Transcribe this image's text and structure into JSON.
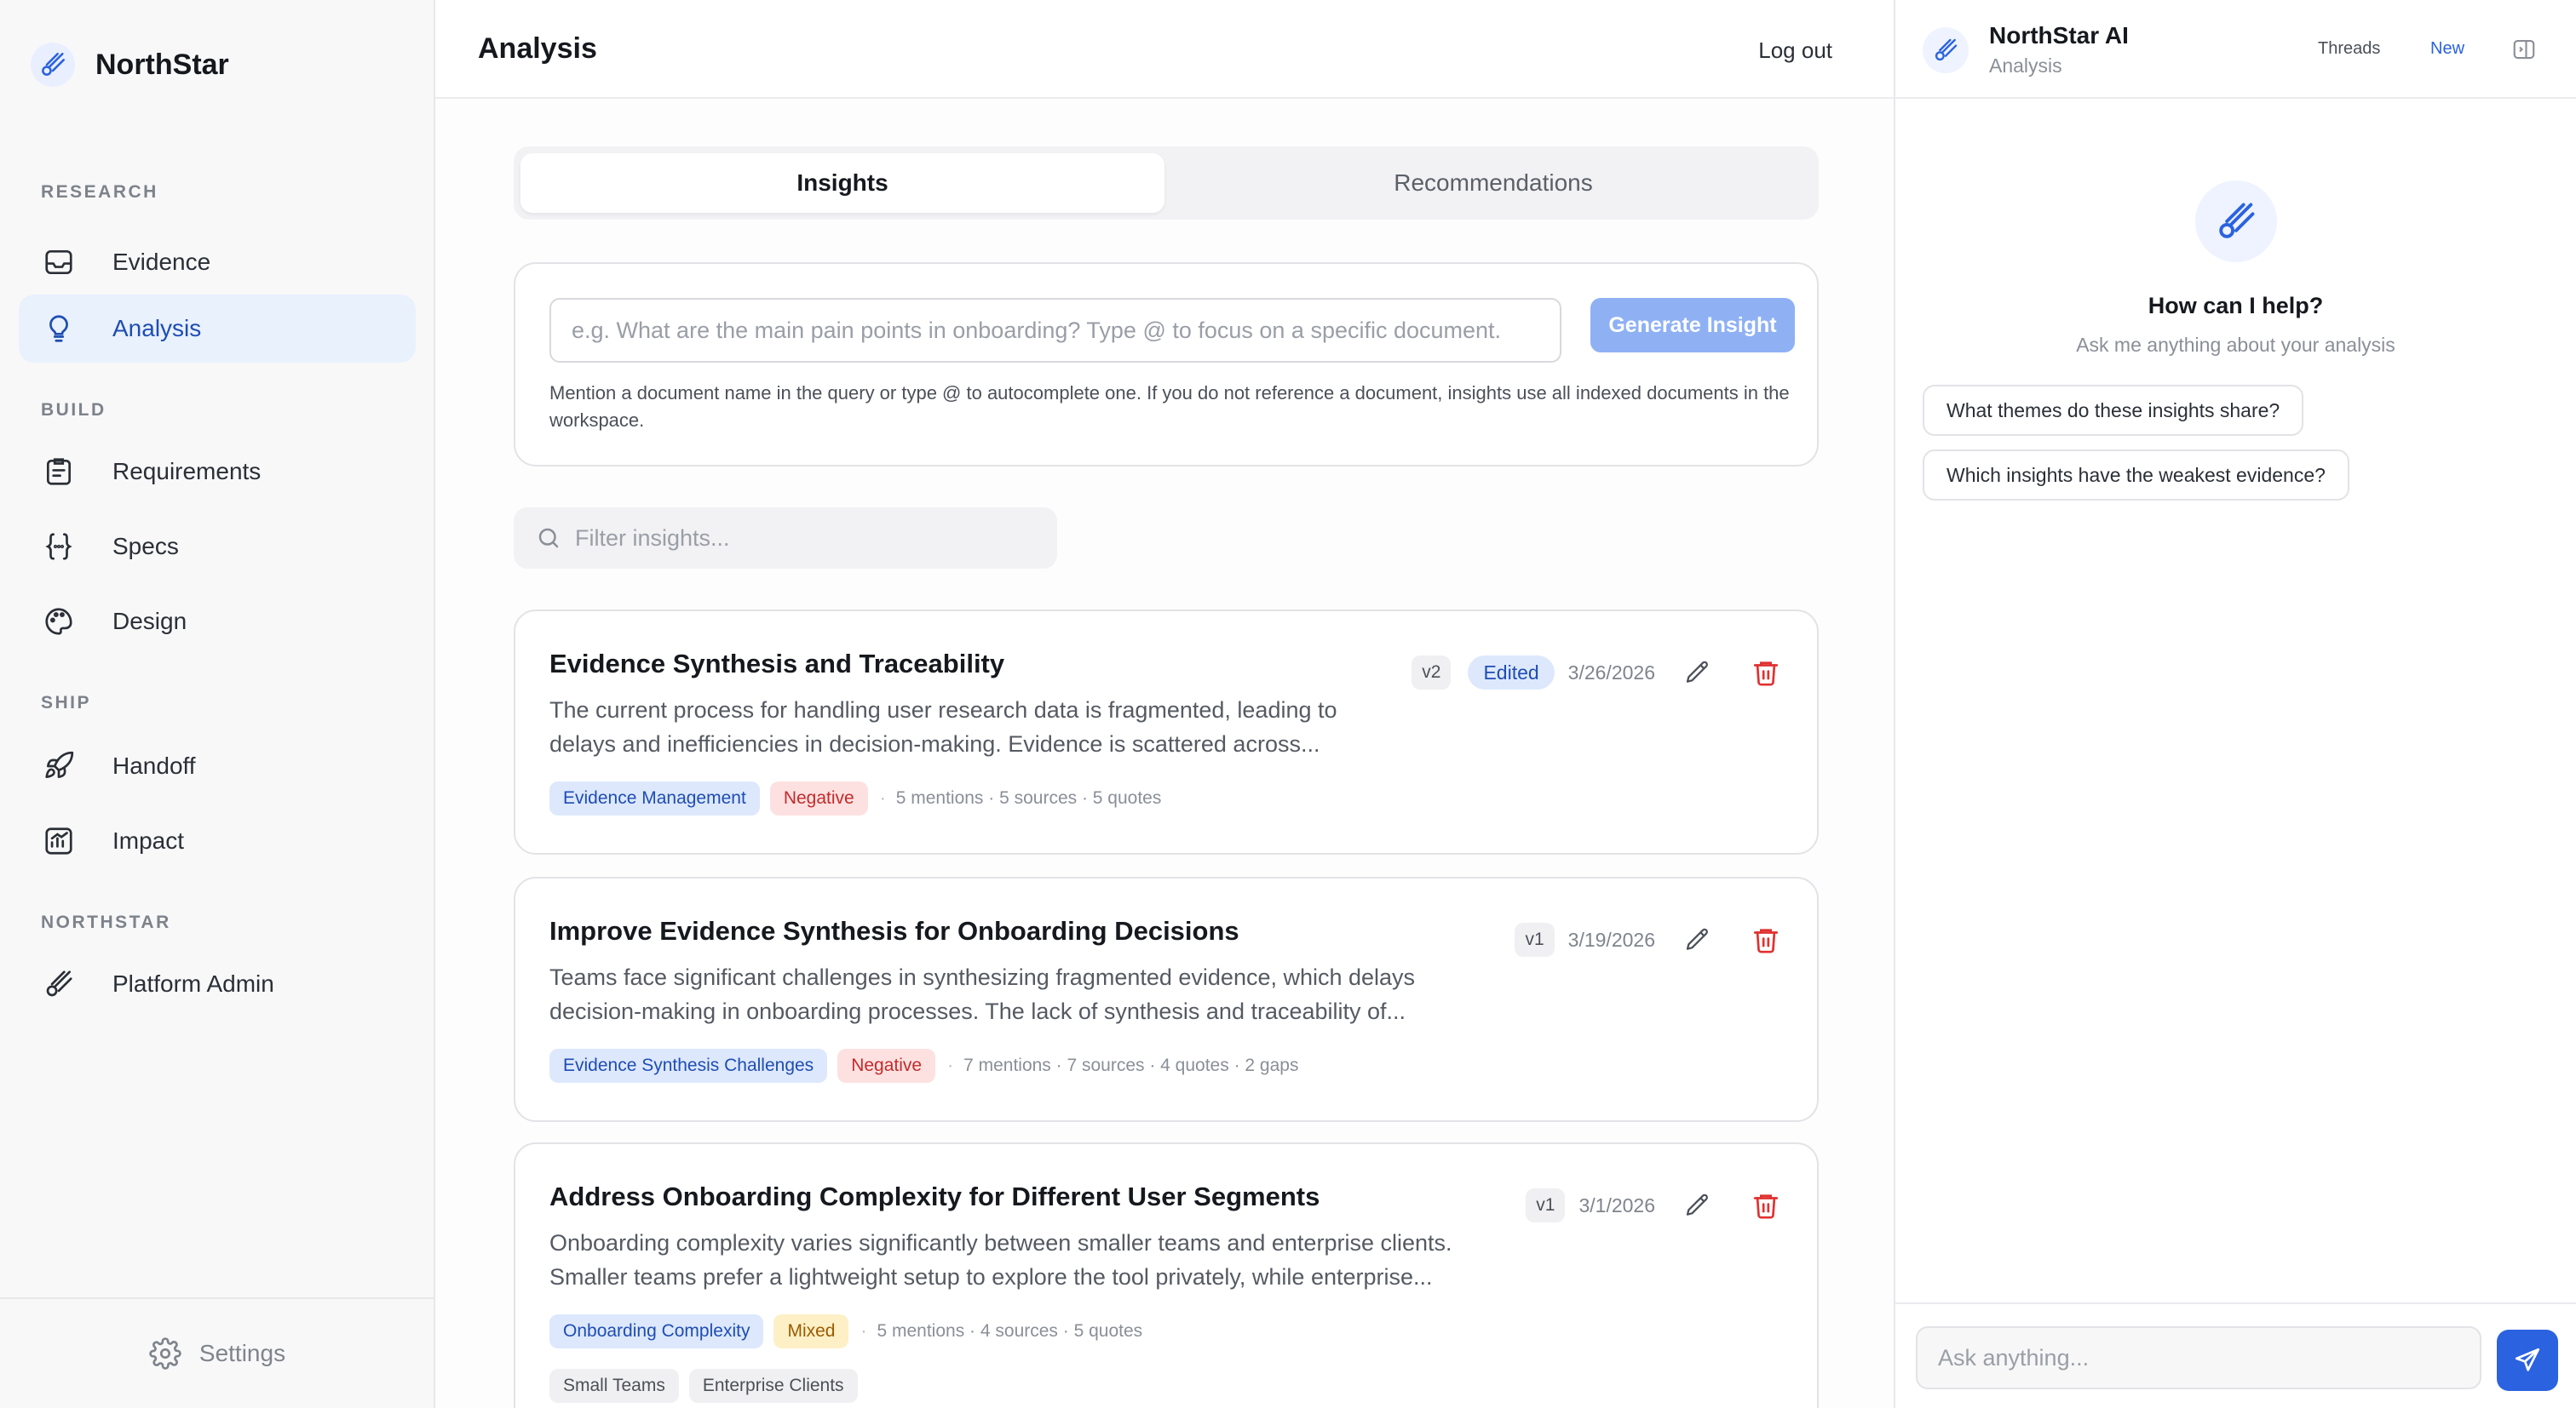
{
  "brand": {
    "name": "NorthStar"
  },
  "nav": {
    "sections": [
      {
        "title": "RESEARCH",
        "items": [
          {
            "label": "Evidence",
            "icon": "inbox-icon"
          },
          {
            "label": "Analysis",
            "icon": "lightbulb-icon",
            "active": true
          }
        ]
      },
      {
        "title": "BUILD",
        "items": [
          {
            "label": "Requirements",
            "icon": "clipboard-list-icon"
          },
          {
            "label": "Specs",
            "icon": "braces-icon"
          },
          {
            "label": "Design",
            "icon": "palette-icon"
          }
        ]
      },
      {
        "title": "SHIP",
        "items": [
          {
            "label": "Handoff",
            "icon": "rocket-icon"
          },
          {
            "label": "Impact",
            "icon": "chart-line-icon"
          }
        ]
      },
      {
        "title": "NORTHSTAR",
        "items": [
          {
            "label": "Platform Admin",
            "icon": "meteor-icon"
          }
        ]
      }
    ],
    "settings_label": "Settings"
  },
  "header": {
    "title": "Analysis",
    "logout": "Log out"
  },
  "tabs": [
    "Insights",
    "Recommendations"
  ],
  "query": {
    "placeholder": "e.g. What are the main pain points in onboarding? Type @ to focus on a specific document.",
    "button": "Generate Insight",
    "help": "Mention a document name in the query or type @ to autocomplete one. If you do not reference a document, insights use all indexed documents in the workspace."
  },
  "filter": {
    "placeholder": "Filter insights..."
  },
  "insights": [
    {
      "title": "Evidence Synthesis and Traceability",
      "desc_line1": "The current process for handling user research data is fragmented, leading to",
      "desc_line2": "delays and inefficiencies in decision-making. Evidence is scattered across...",
      "version": "v2",
      "status": "Edited",
      "date": "3/26/2026",
      "theme": "Evidence Management",
      "sentiment": "Negative",
      "stats": "5 mentions · 5 sources · 5 quotes"
    },
    {
      "title": "Improve Evidence Synthesis for Onboarding Decisions",
      "desc_line1": "Teams face significant challenges in synthesizing fragmented evidence, which delays",
      "desc_line2": "decision-making in onboarding processes. The lack of synthesis and traceability of...",
      "version": "v1",
      "date": "3/19/2026",
      "theme": "Evidence Synthesis Challenges",
      "sentiment": "Negative",
      "stats": "7 mentions · 7 sources · 4 quotes · 2 gaps"
    },
    {
      "title": "Address Onboarding Complexity for Different User Segments",
      "desc_line1": "Onboarding complexity varies significantly between smaller teams and enterprise clients.",
      "desc_line2": "Smaller teams prefer a lightweight setup to explore the tool privately, while enterprise...",
      "version": "v1",
      "date": "3/1/2026",
      "theme": "Onboarding Complexity",
      "sentiment": "Mixed",
      "stats": "5 mentions · 4 sources · 5 quotes",
      "segments": [
        "Small Teams",
        "Enterprise Clients"
      ]
    }
  ],
  "assistant": {
    "title": "NorthStar AI",
    "subtitle": "Analysis",
    "threads": "Threads",
    "new": "New",
    "help_title": "How can I help?",
    "help_sub": "Ask me anything about your analysis",
    "suggestions": [
      "What themes do these insights share?",
      "Which insights have the weakest evidence?"
    ],
    "input_placeholder": "Ask anything..."
  },
  "colors": {
    "accent": "#2a62e0",
    "active_nav_bg": "#e9f1fd",
    "danger": "#e03131"
  }
}
